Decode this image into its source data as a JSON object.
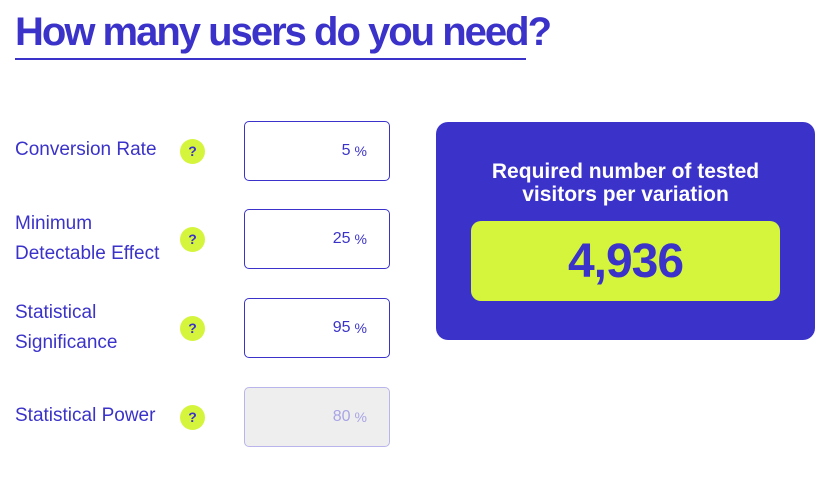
{
  "title": "How many users do you need?",
  "help_glyph": "?",
  "accent_color": "#3b33c9",
  "highlight_color": "#d4f53c",
  "fields": {
    "conversion_rate": {
      "label": "Conversion Rate",
      "value": "5",
      "unit": "%"
    },
    "minimum_detectable_effect": {
      "label_line1": "Minimum",
      "label_line2": "Detectable Effect",
      "value": "25",
      "unit": "%"
    },
    "statistical_significance": {
      "label_line1": "Statistical",
      "label_line2": "Significance",
      "value": "95",
      "unit": "%"
    },
    "statistical_power": {
      "label": "Statistical Power",
      "value": "80",
      "unit": "%",
      "disabled": true
    }
  },
  "result": {
    "heading_line1": "Required number of tested",
    "heading_line2": "visitors per variation",
    "value": "4,936"
  }
}
